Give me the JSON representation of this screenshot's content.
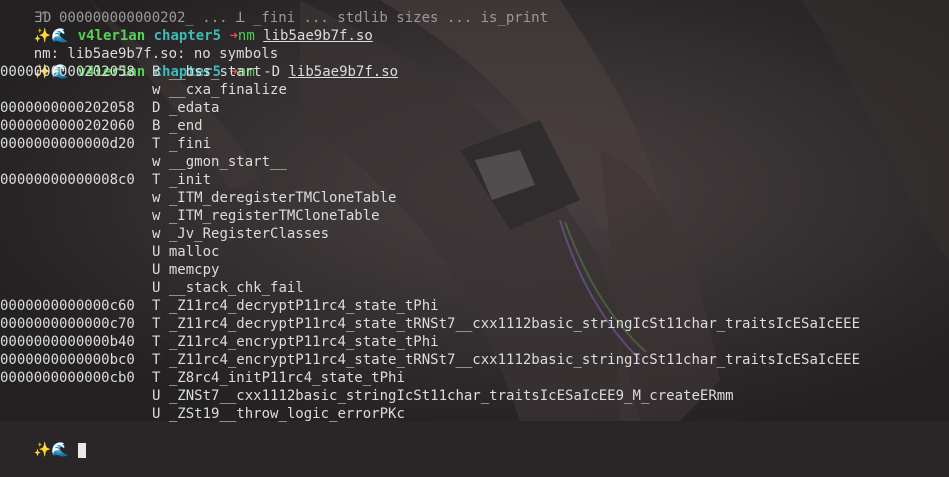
{
  "colors": {
    "prompt_user": "#58d058",
    "prompt_dir": "#3fb8b8",
    "prompt_arrow": "#e25050",
    "command": "#4ccf4c",
    "text": "#dcdcdc",
    "background": "#2a2627"
  },
  "partial_top_line": "ƎƊ 000000000000202̲ ... ꓕ _fini ... stdlib sizes ... is_print",
  "prompts": [
    {
      "emoji": "✨🌊",
      "user": "v4ler1an",
      "dir": "chapter5",
      "arrow": "➜",
      "command": "nm",
      "args": "",
      "file": "lib5ae9b7f.so"
    },
    {
      "emoji": "✨🌊",
      "user": "v4ler1an",
      "dir": "chapter5",
      "arrow": "➜",
      "command": "nm",
      "args": "-D",
      "file": "lib5ae9b7f.so"
    }
  ],
  "outputs": {
    "no_symbols": "nm: lib5ae9b7f.so: no symbols"
  },
  "symbols": [
    {
      "addr": "0000000000202058",
      "type": "B",
      "name": "__bss_start"
    },
    {
      "addr": "",
      "type": "w",
      "name": "__cxa_finalize"
    },
    {
      "addr": "0000000000202058",
      "type": "D",
      "name": "_edata"
    },
    {
      "addr": "0000000000202060",
      "type": "B",
      "name": "_end"
    },
    {
      "addr": "0000000000000d20",
      "type": "T",
      "name": "_fini"
    },
    {
      "addr": "",
      "type": "w",
      "name": "__gmon_start__"
    },
    {
      "addr": "00000000000008c0",
      "type": "T",
      "name": "_init"
    },
    {
      "addr": "",
      "type": "w",
      "name": "_ITM_deregisterTMCloneTable"
    },
    {
      "addr": "",
      "type": "w",
      "name": "_ITM_registerTMCloneTable"
    },
    {
      "addr": "",
      "type": "w",
      "name": "_Jv_RegisterClasses"
    },
    {
      "addr": "",
      "type": "U",
      "name": "malloc"
    },
    {
      "addr": "",
      "type": "U",
      "name": "memcpy"
    },
    {
      "addr": "",
      "type": "U",
      "name": "__stack_chk_fail"
    },
    {
      "addr": "0000000000000c60",
      "type": "T",
      "name": "_Z11rc4_decryptP11rc4_state_tPhi"
    },
    {
      "addr": "0000000000000c70",
      "type": "T",
      "name": "_Z11rc4_decryptP11rc4_state_tRNSt7__cxx1112basic_stringIcSt11char_traitsIcESaIcEEE"
    },
    {
      "addr": "0000000000000b40",
      "type": "T",
      "name": "_Z11rc4_encryptP11rc4_state_tPhi"
    },
    {
      "addr": "0000000000000bc0",
      "type": "T",
      "name": "_Z11rc4_encryptP11rc4_state_tRNSt7__cxx1112basic_stringIcSt11char_traitsIcESaIcEEE"
    },
    {
      "addr": "0000000000000cb0",
      "type": "T",
      "name": "_Z8rc4_initP11rc4_state_tPhi"
    },
    {
      "addr": "",
      "type": "U",
      "name": "_ZNSt7__cxx1112basic_stringIcSt11char_traitsIcESaIcEE9_M_createERmm"
    },
    {
      "addr": "",
      "type": "U",
      "name": "_ZSt19__throw_logic_errorPKc"
    }
  ]
}
